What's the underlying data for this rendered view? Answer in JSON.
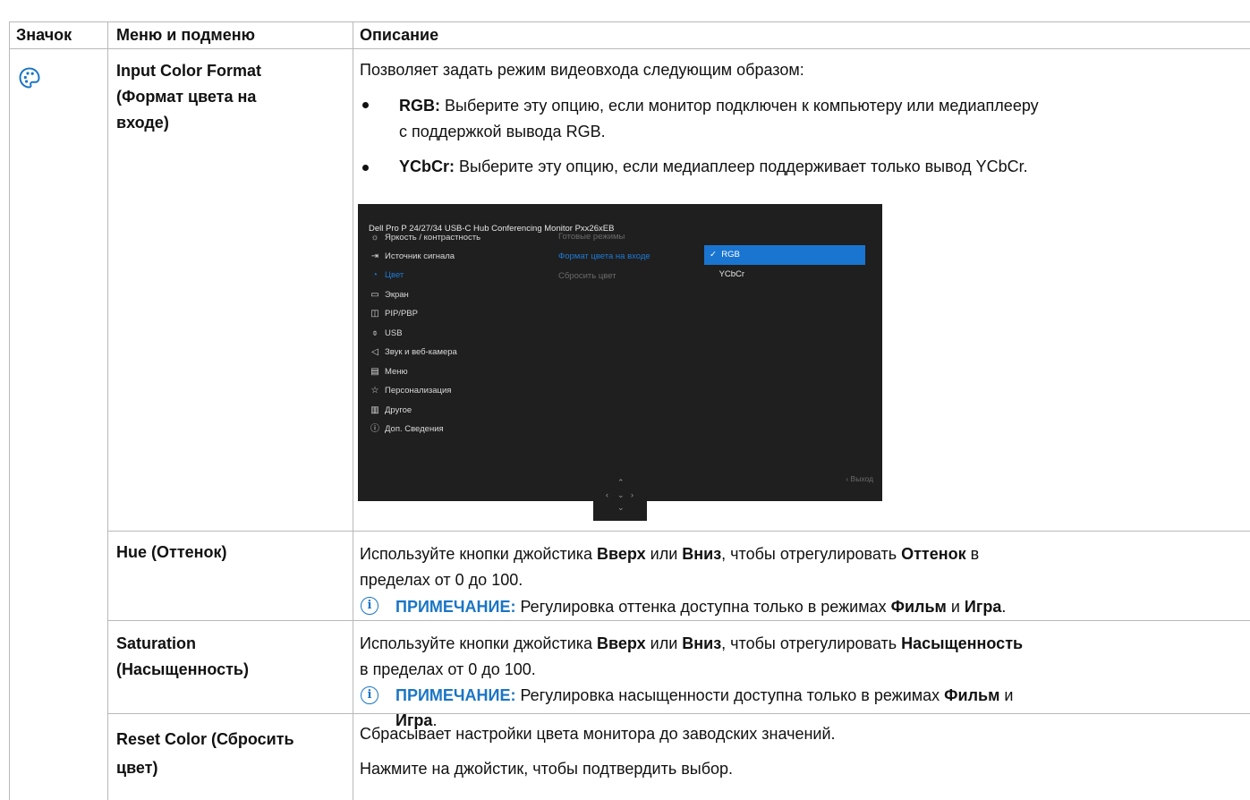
{
  "header": {
    "col_icon": "Значок",
    "col_menu": "Меню и подменю",
    "col_desc": "Описание"
  },
  "rows": {
    "input_color": {
      "menu": "Input Color Format (Формат цвета на входе)",
      "menu_lines": [
        "Input Color Format",
        "(Формат цвета на",
        "входе)"
      ],
      "intro": "Позволяет задать режим видеовхода следующим образом:",
      "bullets": [
        {
          "term": "RGB:",
          "text_lines": [
            "Выберите эту опцию, если монитор подключен к компьютеру или медиаплееру",
            "с поддержкой вывода RGB."
          ]
        },
        {
          "term": "YCbCr:",
          "text_lines": [
            "Выберите эту опцию, если медиаплеер поддерживает только вывод YCbCr."
          ]
        }
      ]
    },
    "hue": {
      "menu": "Hue (Оттенок)",
      "desc_parts": [
        "Используйте кнопки джойстика ",
        "Вверх",
        " или ",
        "Вниз",
        ", чтобы отрегулировать ",
        "Оттенок",
        " в"
      ],
      "desc_line2": "пределах от 0 до 100.",
      "note_label": "ПРИМЕЧАНИЕ:",
      "note_text": " Регулировка оттенка доступна только в режимах ",
      "note_b1": "Фильм",
      "note_and": " и ",
      "note_b2": "Игра",
      "note_end": "."
    },
    "saturation": {
      "menu_lines": [
        "Saturation",
        "(Насыщенность)"
      ],
      "desc_parts": [
        "Используйте кнопки джойстика ",
        "Вверх",
        " или ",
        "Вниз",
        ", чтобы отрегулировать ",
        "Насыщенность"
      ],
      "desc_line2": "в пределах от 0 до 100.",
      "note_label": "ПРИМЕЧАНИЕ:",
      "note_text": " Регулировка насыщенности доступна только в режимах ",
      "note_b1": "Фильм",
      "note_and": " и",
      "note_b2": "Игра",
      "note_end": "."
    },
    "reset": {
      "menu_lines": [
        "Reset Color (Сбросить",
        "цвет)"
      ],
      "line1": "Сбрасывает настройки цвета монитора до заводских значений.",
      "line2": "Нажмите на джойстик, чтобы подтвердить выбор."
    }
  },
  "osd": {
    "title": "Dell Pro P 24/27/34 USB-C Hub Conferencing Monitor  Pxx26xEB",
    "menu": [
      {
        "label": "Яркость / контрастность",
        "icon": "sun-icon"
      },
      {
        "label": "Источник сигнала",
        "icon": "input-icon"
      },
      {
        "label": "Цвет",
        "icon": "palette-icon",
        "active": true
      },
      {
        "label": "Экран",
        "icon": "display-icon"
      },
      {
        "label": "PIP/PBP",
        "icon": "pip-icon"
      },
      {
        "label": "USB",
        "icon": "usb-icon"
      },
      {
        "label": "Звук и веб-камера",
        "icon": "speaker-icon"
      },
      {
        "label": "Меню",
        "icon": "menu-icon"
      },
      {
        "label": "Персонализация",
        "icon": "star-icon"
      },
      {
        "label": "Другое",
        "icon": "other-icon"
      },
      {
        "label": "Доп. Сведения",
        "icon": "info-icon"
      }
    ],
    "submenu": [
      "Готовые режимы",
      "Формат цвета на входе",
      "Сбросить цвет"
    ],
    "options": [
      "RGB",
      "YCbCr"
    ],
    "exit": "‹  Выход",
    "accent": "#1a75d1"
  },
  "colors": {
    "accent_blue": "#1a75c5",
    "border": "#b9b9b9"
  }
}
